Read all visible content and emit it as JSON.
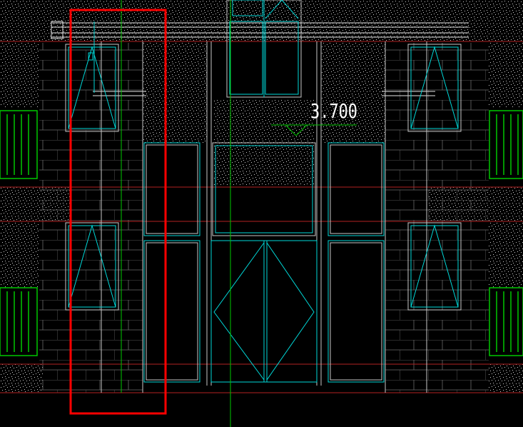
{
  "viewport": {
    "background": "#000000"
  },
  "drawing": {
    "level_marker_text": "3.700",
    "colors": {
      "wall": "#a8a8a8",
      "window": "#00d8d8",
      "railing": "#00c800",
      "ground": "#b22222",
      "axis": "#00c800",
      "dimension": "#00d8d8",
      "door": "#00d8d8",
      "highlight": "#ff0000",
      "stipple": "#cfcfcf",
      "text": "#ffffff"
    },
    "selection_box": {
      "label": "",
      "stroke": "#ff0000"
    }
  }
}
